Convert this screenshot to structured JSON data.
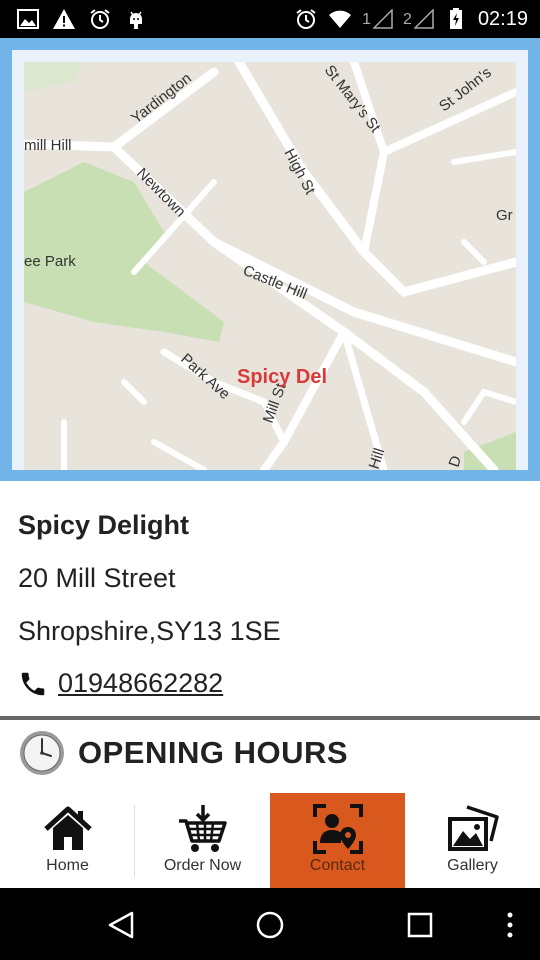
{
  "status_bar": {
    "time": "02:19",
    "sim1": "1",
    "sim2": "2"
  },
  "map": {
    "marker_label": "Spicy Del",
    "labels": {
      "yardington": "Yardington",
      "mill_hill_left": "mill Hill",
      "st_marys": "St Mary's St",
      "st_johns": "St John's",
      "high_st": "High St",
      "newtown": "Newtown",
      "gr": "Gr",
      "park": "ee Park",
      "castle_hill": "Castle Hill",
      "park_ave": "Park Ave",
      "mill_st": "Mill St",
      "hill": "Hill",
      "d": "D"
    }
  },
  "business": {
    "name": "Spicy Delight",
    "address_line1": "20 Mill Street",
    "address_line2": "Shropshire,SY13 1SE",
    "phone": "01948662282"
  },
  "hours": {
    "title": "OPENING HOURS"
  },
  "tabs": [
    {
      "label": "Home",
      "icon": "home-icon"
    },
    {
      "label": "Order Now",
      "icon": "cart-icon"
    },
    {
      "label": "Contact",
      "icon": "contact-icon",
      "active": true
    },
    {
      "label": "Gallery",
      "icon": "gallery-icon"
    }
  ],
  "colors": {
    "accent": "#d9581d",
    "map_border": "#73b4e8",
    "marker": "#d83a3a"
  }
}
